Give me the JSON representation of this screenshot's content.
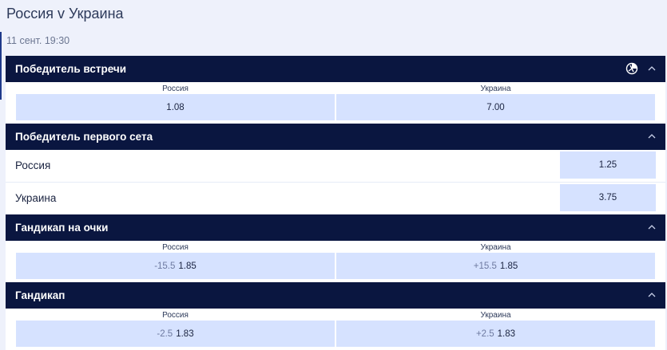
{
  "event": {
    "title": "Россия v Украина",
    "date": "11 сент. 19:30"
  },
  "markets": {
    "winner": {
      "title": "Победитель встречи",
      "home_label": "Россия",
      "home_odds": "1.08",
      "away_label": "Украина",
      "away_odds": "7.00"
    },
    "first_set": {
      "title": "Победитель первого сета",
      "rows": [
        {
          "name": "Россия",
          "odds": "1.25"
        },
        {
          "name": "Украина",
          "odds": "3.75"
        }
      ]
    },
    "points_handicap": {
      "title": "Гандикап на очки",
      "home_label": "Россия",
      "home_line": "-15.5",
      "home_odds": "1.85",
      "away_label": "Украина",
      "away_line": "+15.5",
      "away_odds": "1.85"
    },
    "handicap": {
      "title": "Гандикап",
      "home_label": "Россия",
      "home_line": "-2.5",
      "home_odds": "1.83",
      "away_label": "Украина",
      "away_line": "+2.5",
      "away_odds": "1.83"
    }
  },
  "icons": {
    "stats": "stats-icon",
    "collapse": "chevron-up-icon"
  },
  "colors": {
    "header_bg": "#0a1640",
    "odds_bg": "#d6e2ff",
    "page_bg": "#eef1fb"
  }
}
